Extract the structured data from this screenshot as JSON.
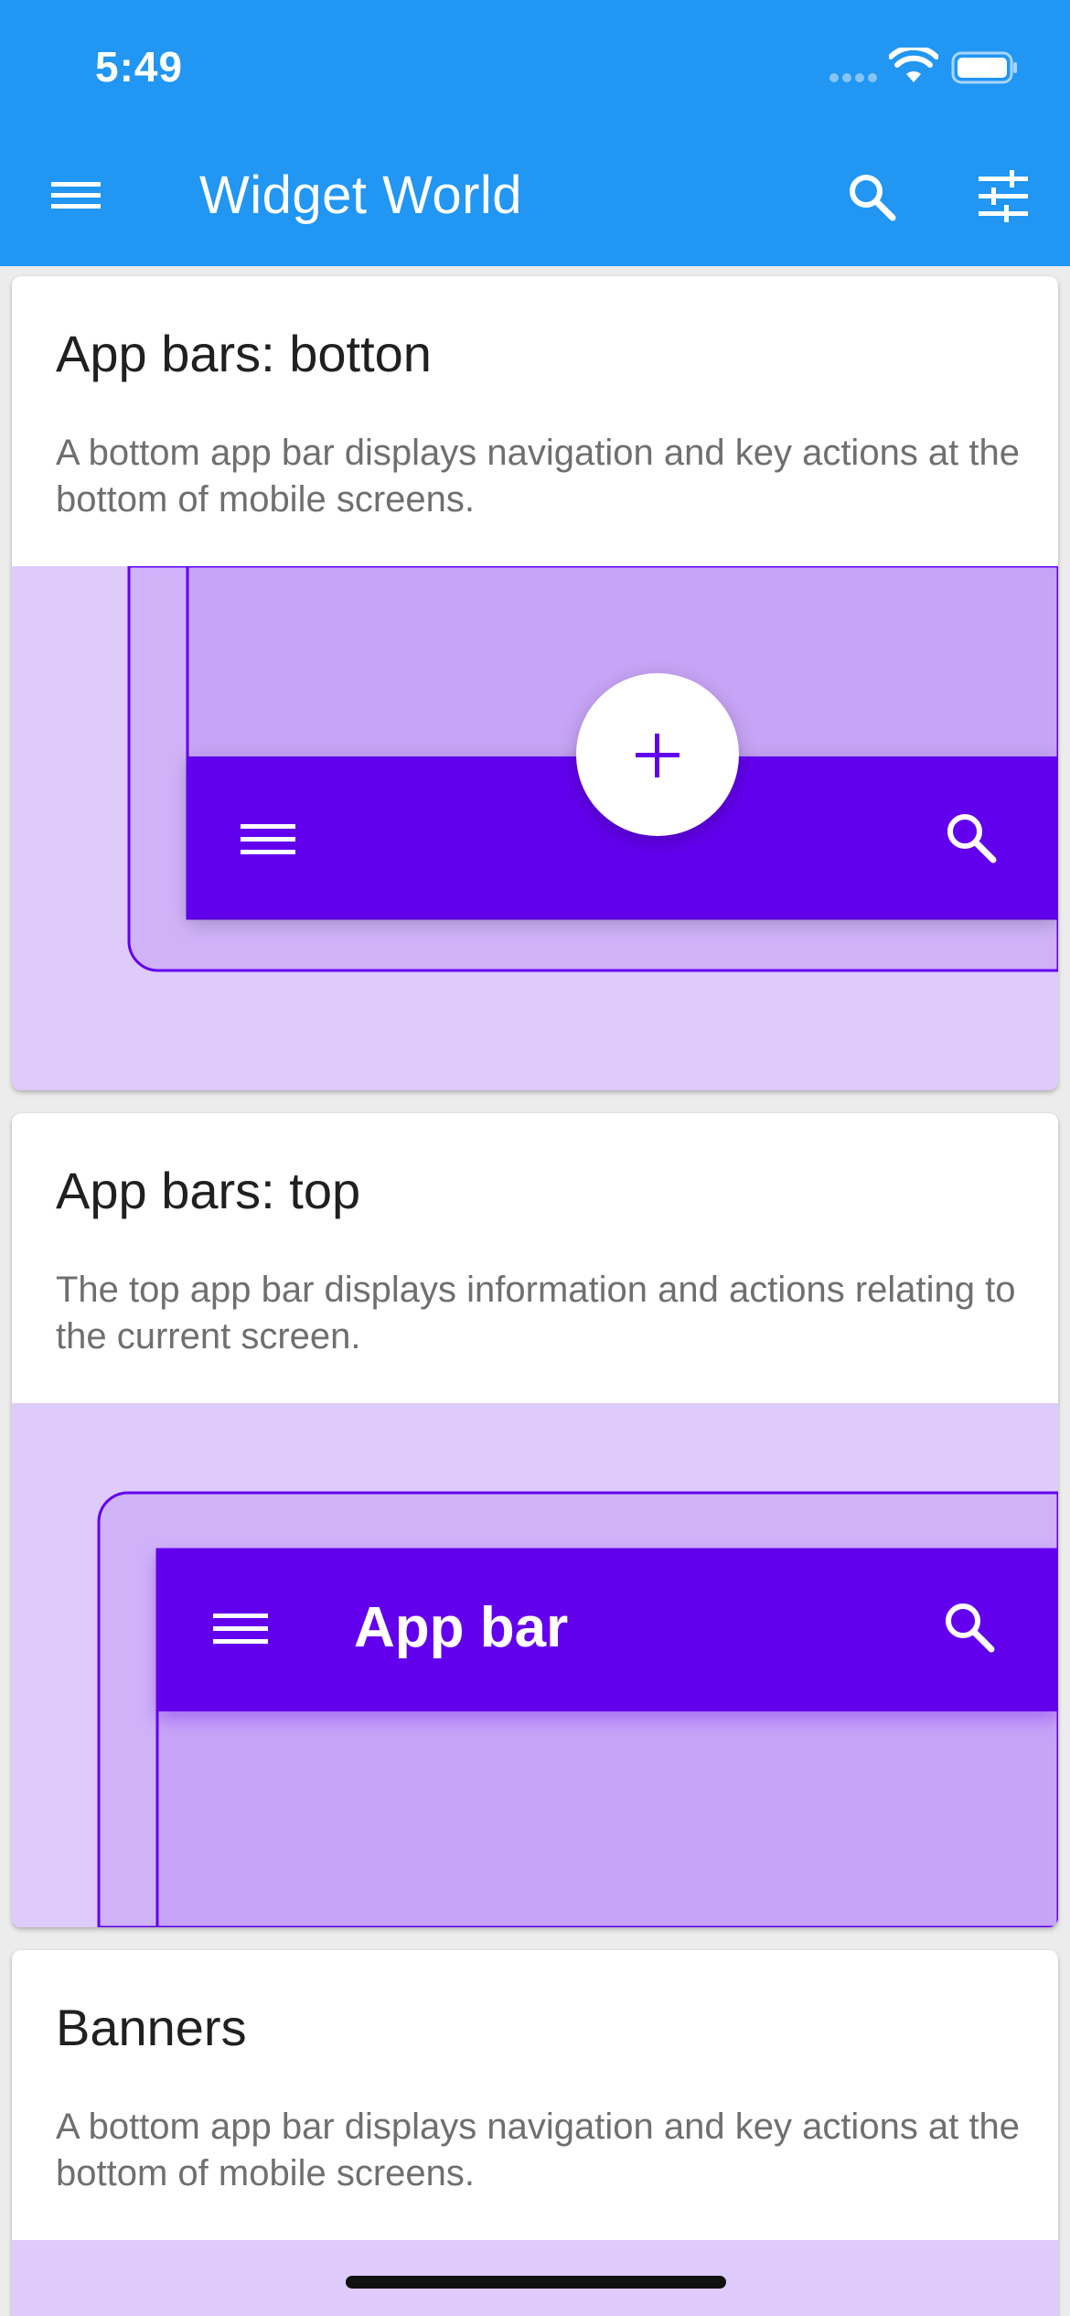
{
  "status_bar": {
    "time": "5:49"
  },
  "app_bar": {
    "title": "Widget World",
    "menu_icon": "menu-icon",
    "search_icon": "search-icon",
    "filter_icon": "tune-icon",
    "color": "#2196f3"
  },
  "cards": [
    {
      "title": "App bars: botton",
      "description": "A bottom app bar displays navigation and key actions at the bottom of mobile screens.",
      "illustration": {
        "fab_icon": "plus-icon",
        "bar_icons": [
          "menu-icon",
          "search-icon"
        ]
      }
    },
    {
      "title": "App bars: top",
      "description": "The top app bar displays information and actions relating to the current screen.",
      "illustration": {
        "bar_title": "App bar",
        "bar_icons": [
          "menu-icon",
          "search-icon"
        ]
      }
    },
    {
      "title": "Banners",
      "description": "A bottom app bar displays navigation and key actions at the bottom of mobile screens."
    }
  ],
  "colors": {
    "illustration_background": "#dfcbfb",
    "device_frame": "#d0b2f9",
    "device_screen": "#c7a4f6",
    "illustration_bar": "#6200ee"
  }
}
